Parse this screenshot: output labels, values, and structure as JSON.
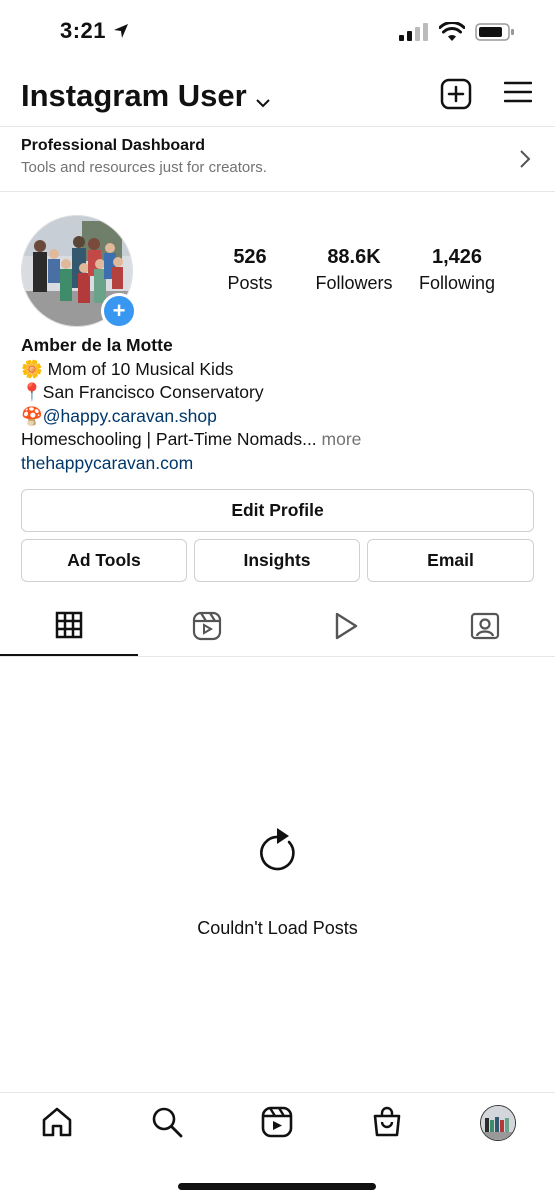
{
  "status_bar": {
    "time": "3:21"
  },
  "header": {
    "username": "Instagram User"
  },
  "pro_dashboard": {
    "title": "Professional Dashboard",
    "subtitle": "Tools and resources just for creators."
  },
  "stats": [
    {
      "value": "526",
      "label": "Posts"
    },
    {
      "value": "88.6K",
      "label": "Followers"
    },
    {
      "value": "1,426",
      "label": "Following"
    }
  ],
  "bio": {
    "name": "Amber de la Motte",
    "line1": "Mom of 10 Musical Kids",
    "line2": "San Francisco Conservatory",
    "line3": "@happy.caravan.shop",
    "line4": "Homeschooling | Part-Time Nomads...",
    "more": "more",
    "website": "thehappycaravan.com"
  },
  "buttons": {
    "edit_profile": "Edit Profile",
    "ad_tools": "Ad Tools",
    "insights": "Insights",
    "email": "Email"
  },
  "tabs": [
    "grid-icon",
    "reels-icon",
    "video-icon",
    "tagged-icon"
  ],
  "empty_state": {
    "message": "Couldn't Load Posts"
  },
  "bottom_nav": [
    "home-icon",
    "search-icon",
    "reels-icon",
    "shop-icon",
    "profile-avatar"
  ]
}
